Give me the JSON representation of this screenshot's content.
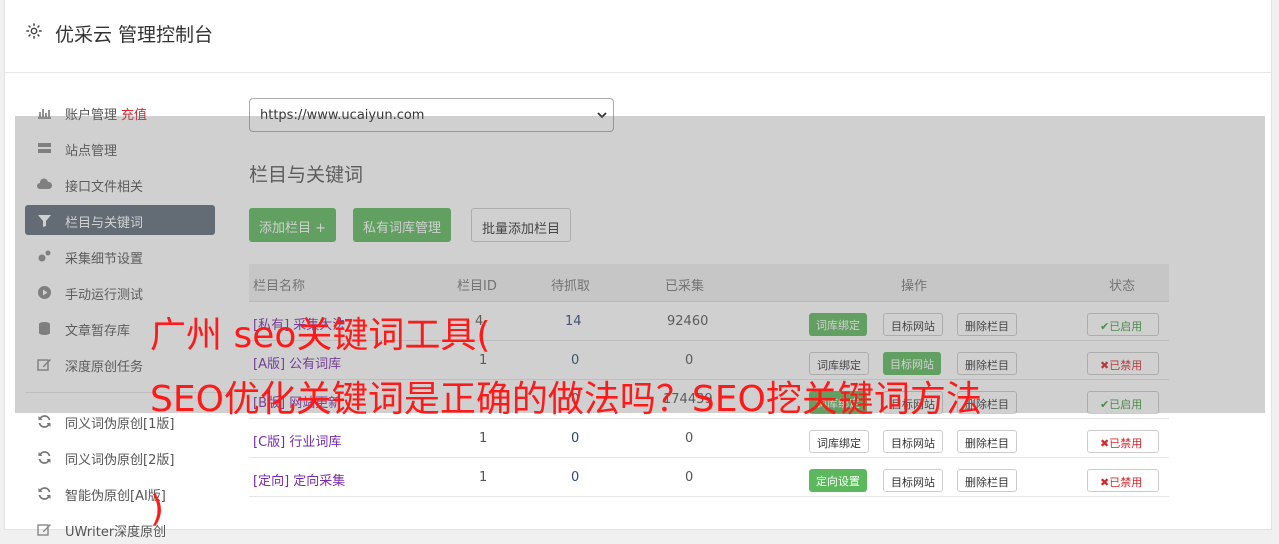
{
  "header": {
    "title": "优采云 管理控制台",
    "icon": "gear-icon"
  },
  "sidebar": {
    "items": [
      {
        "label": "账户管理",
        "extra": "充值",
        "icon": "bar-chart-icon"
      },
      {
        "label": "站点管理",
        "icon": "server-icon"
      },
      {
        "label": "接口文件相关",
        "icon": "cloud-upload-icon"
      },
      {
        "label": "栏目与关键词",
        "icon": "filter-icon",
        "active": true
      },
      {
        "label": "采集细节设置",
        "icon": "gears-icon"
      },
      {
        "label": "手动运行测试",
        "icon": "play-circle-icon"
      },
      {
        "label": "文章暂存库",
        "icon": "database-icon"
      },
      {
        "label": "深度原创任务",
        "icon": "edit-icon"
      },
      {
        "label": "同义词伪原创[1版]",
        "icon": "refresh-icon"
      },
      {
        "label": "同义词伪原创[2版]",
        "icon": "refresh-icon"
      },
      {
        "label": "智能伪原创[AI版]",
        "icon": "refresh-icon"
      },
      {
        "label": "UWriter深度原创",
        "icon": "edit-icon"
      }
    ]
  },
  "site_select": {
    "value": "https://www.ucaiyun.com"
  },
  "main": {
    "section_title": "栏目与关键词",
    "buttons": {
      "add_column": "添加栏目 +",
      "private_lib": "私有词库管理",
      "batch_add": "批量添加栏目"
    }
  },
  "table": {
    "headers": {
      "name": "栏目名称",
      "id": "栏目ID",
      "pending": "待抓取",
      "collected": "已采集",
      "ops": "操作",
      "status": "状态"
    },
    "rows": [
      {
        "name": "[私有] 采集大法",
        "id": "4",
        "pending": "14",
        "collected": "92460",
        "op1": "词库绑定",
        "op2": "目标网站",
        "op3": "删除栏目",
        "status": "✔已启用"
      },
      {
        "name": "[A版] 公有词库",
        "id": "1",
        "pending": "0",
        "collected": "0",
        "op1": "词库绑定",
        "op2": "目标网站",
        "op3": "删除栏目",
        "status": "✖已禁用"
      },
      {
        "name": "[B版] 网站更新",
        "id": "",
        "pending": "0",
        "collected": "174439",
        "op1": "词库绑定",
        "op2": "目标网站",
        "op3": "删除栏目",
        "status": "✔已启用"
      },
      {
        "name": "[C版] 行业词库",
        "id": "1",
        "pending": "0",
        "collected": "0",
        "op1": "词库绑定",
        "op2": "目标网站",
        "op3": "删除栏目",
        "status": "✖已禁用"
      },
      {
        "name": "[定向] 定向采集",
        "id": "1",
        "pending": "0",
        "collected": "0",
        "op1": "定向设置",
        "op2": "目标网站",
        "op3": "删除栏目",
        "status": "✖已禁用"
      }
    ]
  },
  "watermark": {
    "line1": "广州 seo关键词工具(",
    "line2": "SEO优化关键词是正确的做法吗？SEO挖关键词方法",
    "line3": ")"
  },
  "colors": {
    "accent_green": "#5cb85c",
    "active_nav": "#5f6b7a",
    "danger": "#d9252b",
    "watermark": "#ff1a1a"
  }
}
